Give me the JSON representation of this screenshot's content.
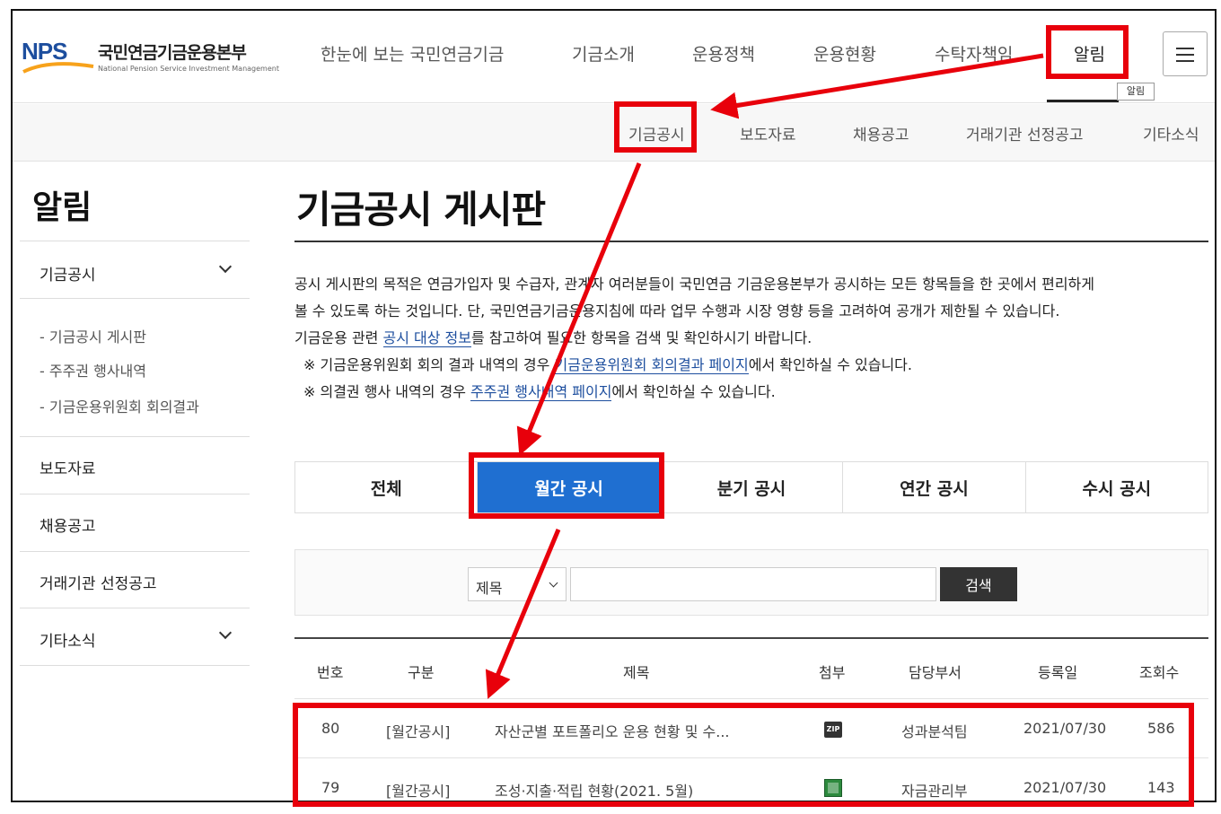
{
  "header": {
    "logo_mark": "NPS",
    "logo_korean": "국민연금기금운용본부",
    "logo_english": "National Pension Service Investment Management",
    "nav": [
      "한눈에 보는 국민연금기금",
      "기금소개",
      "운용정책",
      "운용현황",
      "수탁자책임",
      "알림"
    ],
    "tooltip": "알림"
  },
  "subnav": [
    "기금공시",
    "보도자료",
    "채용공고",
    "거래기관 선정공고",
    "기타소식"
  ],
  "sidebar": {
    "title": "알림",
    "items": [
      {
        "label": "기금공시",
        "sub": [
          "- 기금공시 게시판",
          "- 주주권 행사내역",
          "- 기금운용위원회 회의결과"
        ]
      },
      {
        "label": "보도자료"
      },
      {
        "label": "채용공고"
      },
      {
        "label": "거래기관 선정공고"
      },
      {
        "label": "기타소식"
      }
    ]
  },
  "main": {
    "title": "기금공시 게시판",
    "intro": {
      "line1": "공시 게시판의 목적은 연금가입자 및 수급자, 관계자 여러분들이 국민연금 기금운용본부가 공시하는 모든 항목들을 한 곳에서 편리하게",
      "line2": "볼 수 있도록 하는 것입니다. 단, 국민연금기금운용지침에 따라 업무 수행과 시장 영향 등을 고려하여 공개가 제한될 수 있습니다.",
      "line3_pre": "기금운용 관련 ",
      "line3_link": "공시 대상 정보",
      "line3_post": "를 참고하여 필요한 항목을 검색 및 확인하시기 바랍니다.",
      "line4_pre": "※ 기금운용위원회 회의 결과 내역의 경우 ",
      "line4_link": "기금운용위원회 회의결과 페이지",
      "line4_post": "에서 확인하실 수 있습니다.",
      "line5_pre": "※ 의결권 행사 내역의 경우 ",
      "line5_link": "주주권 행사내역 페이지",
      "line5_post": "에서 확인하실 수 있습니다."
    },
    "tabs": [
      "전체",
      "월간 공시",
      "분기 공시",
      "연간 공시",
      "수시 공시"
    ],
    "active_tab": "월간 공시",
    "search": {
      "select_value": "제목",
      "input_value": "",
      "button": "검색"
    },
    "table": {
      "headers": [
        "번호",
        "구분",
        "제목",
        "첨부",
        "담당부서",
        "등록일",
        "조회수"
      ],
      "rows": [
        {
          "no": "80",
          "category": "[월간공시]",
          "title": "자산군별 포트폴리오 운용 현황 및 수...",
          "attachment": "zip",
          "dept": "성과분석팀",
          "date": "2021/07/30",
          "views": "586"
        },
        {
          "no": "79",
          "category": "[월간공시]",
          "title": "조성·지출·적립 현황(2021. 5월)",
          "attachment": "xls",
          "dept": "자금관리부",
          "date": "2021/07/30",
          "views": "143"
        }
      ]
    }
  },
  "colors": {
    "accent": "#1f6fd1",
    "annotation": "#e8000b",
    "brand": "#1d4e9e"
  }
}
